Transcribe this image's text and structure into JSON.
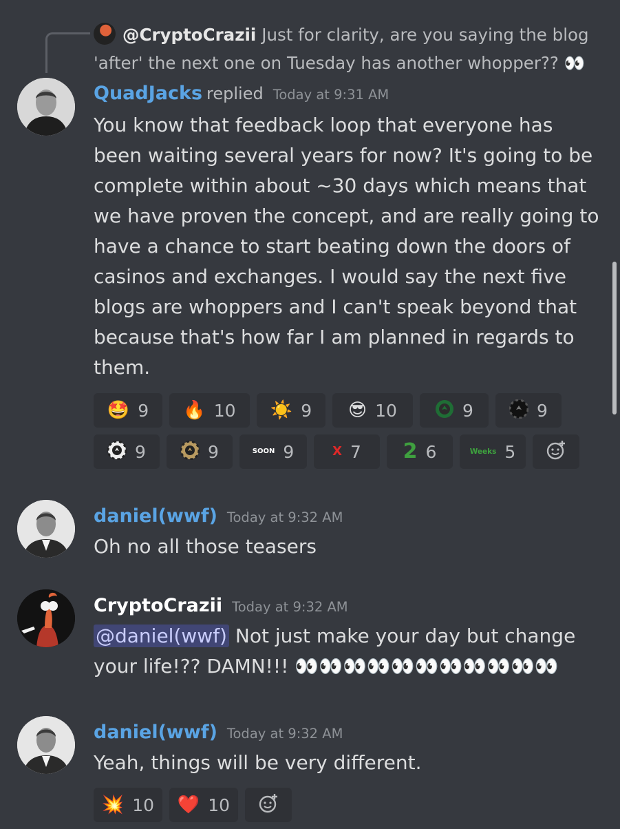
{
  "reply_reference": {
    "username": "@CryptoCrazii",
    "text": "Just for clarity, are you saying the blog 'after' the next one on Tuesday has another whopper??",
    "emoji": "👀"
  },
  "messages": [
    {
      "username": "QuadJacks",
      "replied_label": "replied",
      "timestamp": "Today at 9:31 AM",
      "text": "You know that feedback loop that everyone has been waiting several years for now? It's going to be complete within about ~30 days which means that we have proven the concept, and are really going to have a chance to start beating down the doors of casinos and exchanges. I would say the next five blogs are whoppers and I can't speak beyond that because that's how far I am planned in regards to them.",
      "reactions_row1": [
        {
          "emoji": "🤩",
          "count": "9"
        },
        {
          "emoji": "🔥",
          "count": "10"
        },
        {
          "emoji": "☀️",
          "count": "9"
        },
        {
          "emoji": "😎",
          "count": "10"
        },
        {
          "emoji": "poker-chip-green-icon",
          "count": "9"
        },
        {
          "emoji": "poker-chip-black-icon",
          "count": "9"
        }
      ],
      "reactions_row2": [
        {
          "emoji": "poker-chip-white-icon",
          "count": "9"
        },
        {
          "emoji": "poker-chip-gold-icon",
          "count": "9"
        },
        {
          "emoji": "SOON",
          "count": "9"
        },
        {
          "emoji": "X",
          "count": "7"
        },
        {
          "emoji": "2",
          "count": "6"
        },
        {
          "emoji": "Weeks",
          "count": "5"
        }
      ]
    },
    {
      "username": "daniel(wwf)",
      "timestamp": "Today at 9:32 AM",
      "text": "Oh no all those teasers"
    },
    {
      "username": "CryptoCrazii",
      "timestamp": "Today at 9:32 AM",
      "mention": "@daniel(wwf)",
      "text": "Not just make your day but change your life!?? DAMN!!!",
      "emoji": "👀👀👀👀👀👀👀👀👀👀👀"
    },
    {
      "username": "daniel(wwf)",
      "timestamp": "Today at 9:32 AM",
      "text": "Yeah, things will be very different.",
      "reactions": [
        {
          "emoji": "💥",
          "count": "10"
        },
        {
          "emoji": "❤️",
          "count": "10"
        }
      ]
    }
  ],
  "add_reaction_icon": "add-reaction-smiley-icon",
  "colors": {
    "background": "#36393f",
    "reaction_bg": "#2f3136",
    "username_blue": "#5aa4e4",
    "mention_bg": "#414675"
  }
}
